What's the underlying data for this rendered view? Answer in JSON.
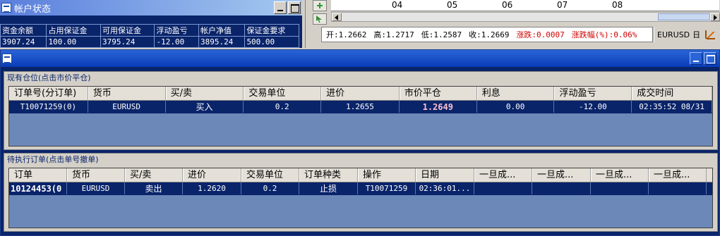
{
  "account_panel": {
    "title": "帐户状态",
    "columns": [
      "资金余额",
      "占用保证金",
      "可用保证金",
      "浮动盈亏",
      "帐户净值",
      "保证金要求"
    ],
    "values": [
      "3907.24",
      "100.00",
      "3795.24",
      "-12.00",
      "3895.24",
      "500.00"
    ]
  },
  "chart": {
    "axis_labels": [
      "04",
      "05",
      "06",
      "07",
      "08"
    ],
    "open": "开:1.2662",
    "high": "高:1.2717",
    "low": "低:1.2587",
    "close": "收:1.2669",
    "change": "涨跌:0.0007",
    "change_pct": "涨跌幅(%):0.06%",
    "symbol": "EURUSD",
    "period": "日"
  },
  "positions": {
    "legend": "现有仓位(点击市价平仓)",
    "columns": [
      "订单号(分订单)",
      "货币",
      "买/卖",
      "交易单位",
      "进价",
      "市价平仓",
      "利息",
      "浮动盈亏",
      "成交时间"
    ],
    "rows": [
      [
        "T10071259(0)",
        "EURUSD",
        "买入",
        "0.2",
        "1.2655",
        "1.2649",
        "0.00",
        "-12.00",
        "02:35:52 08/31"
      ]
    ]
  },
  "pending": {
    "legend": "待执行订单(点击单号撤单)",
    "columns": [
      "订单",
      "货币",
      "买/卖",
      "进价",
      "交易单位",
      "订单种类",
      "操作",
      "日期",
      "一旦成...",
      "一旦成...",
      "一旦成...",
      "一旦成..."
    ],
    "rows": [
      [
        "10124453(0",
        "EURUSD",
        "卖出",
        "1.2620",
        "0.2",
        "止损",
        "T10071259",
        "02:36:01...",
        "",
        "",
        "",
        ""
      ]
    ]
  },
  "colors": {
    "selection": "#0a246a",
    "grid_empty": "#6c88b8",
    "highlight_price": "#ffc0d0",
    "ohlc_red": "#d00000"
  }
}
